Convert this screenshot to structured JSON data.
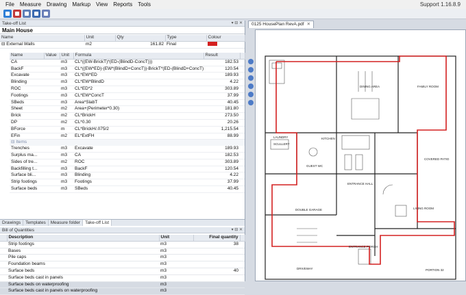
{
  "menu": {
    "items": [
      "File",
      "Measure",
      "Drawing",
      "Markup",
      "View",
      "Reports",
      "Tools"
    ],
    "support": "Support",
    "version": "1.16.8.9"
  },
  "takeoff": {
    "pane_title": "Take-off List",
    "project_title": "Main House",
    "headers": [
      "Name",
      "Unit",
      "Qty",
      "Type",
      "Colour"
    ],
    "item": {
      "name": "External Walls",
      "unit": "m2",
      "qty": "161.82",
      "type": "Final",
      "colour": "#d42020"
    },
    "sub_headers": [
      "Name",
      "Value",
      "Unit",
      "Formula",
      "Result"
    ],
    "rows": [
      {
        "name": "CA",
        "value": "",
        "unit": "m3",
        "formula": "CL*((EW-BrickT)*(ED-(BlindD-ConcT)))",
        "result": "182.53"
      },
      {
        "name": "BackF",
        "value": "",
        "unit": "m3",
        "formula": "CL*((EW*ED)-(EW*(BlindD+ConcT))-BrickT*(ED-(BlindD+ConcT)))",
        "result": "120.54"
      },
      {
        "name": "Excavate",
        "value": "",
        "unit": "m3",
        "formula": "CL*EW*ED",
        "result": "189.93"
      },
      {
        "name": "Blinding",
        "value": "",
        "unit": "m3",
        "formula": "CL*EW*BlindD",
        "result": "4.22"
      },
      {
        "name": "ROC",
        "value": "",
        "unit": "m3",
        "formula": "CL*ED*2",
        "result": "303.89"
      },
      {
        "name": "Footings",
        "value": "",
        "unit": "m3",
        "formula": "CL*EW*ConcT",
        "result": "37.99"
      },
      {
        "name": "SBeds",
        "value": "",
        "unit": "m3",
        "formula": "Area*SlabT",
        "result": "40.45"
      },
      {
        "name": "Sheet",
        "value": "",
        "unit": "m2",
        "formula": "Area+(Perimeter*0.30)",
        "result": "181.80"
      },
      {
        "name": "Brick",
        "value": "",
        "unit": "m2",
        "formula": "CL*BrickH",
        "result": "273.50"
      },
      {
        "name": "DP",
        "value": "",
        "unit": "m2",
        "formula": "CL*0.30",
        "result": "20.26"
      },
      {
        "name": "BForce",
        "value": "",
        "unit": "m",
        "formula": "CL*BrickH/.075/2",
        "result": "1,215.54"
      },
      {
        "name": "EFin",
        "value": "",
        "unit": "m2",
        "formula": "EL*ExtFH",
        "result": "88.99"
      }
    ],
    "group_label": "Items",
    "item_rows": [
      {
        "name": "Trenches",
        "unit": "m3",
        "formula": "Excavate",
        "result": "189.93"
      },
      {
        "name": "Surplus ma...",
        "unit": "m3",
        "formula": "CA",
        "result": "182.53"
      },
      {
        "name": "Sides of tre...",
        "unit": "m2",
        "formula": "ROC",
        "result": "303.89"
      },
      {
        "name": "Backfilling t...",
        "unit": "m3",
        "formula": "BackF",
        "result": "120.54"
      },
      {
        "name": "Surface bli...",
        "unit": "m3",
        "formula": "Blinding",
        "result": "4.22"
      },
      {
        "name": "Strip footings",
        "unit": "m3",
        "formula": "Footings",
        "result": "37.99"
      },
      {
        "name": "Surface beds",
        "unit": "m3",
        "formula": "SBeds",
        "result": "40.45"
      }
    ]
  },
  "tabs": [
    "Drawings",
    "Templates",
    "Measure folder",
    "Take-off List"
  ],
  "boq": {
    "title": "Bill of Quantities",
    "headers": [
      "Description",
      "Unit",
      "Final quantity"
    ],
    "rows": [
      {
        "description": "Strip footings",
        "unit": "m3",
        "qty": "38"
      },
      {
        "description": "Bases",
        "unit": "m3",
        "qty": ""
      },
      {
        "description": "Pile caps",
        "unit": "m3",
        "qty": ""
      },
      {
        "description": "Foundation beams",
        "unit": "m3",
        "qty": ""
      },
      {
        "description": "Surface beds",
        "unit": "m3",
        "qty": "40"
      },
      {
        "description": "Surface beds cast in panels",
        "unit": "m3",
        "qty": ""
      },
      {
        "description": "Surface beds on waterproofing",
        "unit": "m3",
        "qty": ""
      },
      {
        "description": "Surface beds cast in panels on waterproofing",
        "unit": "m3",
        "qty": ""
      }
    ]
  },
  "document": {
    "tab_label": "0125 HousePlan RevA.pdf",
    "rooms": [
      "DINING AREA",
      "FAMILY ROOM",
      "KITCHEN",
      "LAUNDRY",
      "SCULLERY",
      "COVERED PATIO",
      "GUEST WC",
      "ENTRANCE HALL",
      "DOUBLE GARAGE",
      "LIVING ROOM",
      "ENTRANCE PORCH",
      "DRIVEWAY",
      "PORTION 32"
    ]
  }
}
